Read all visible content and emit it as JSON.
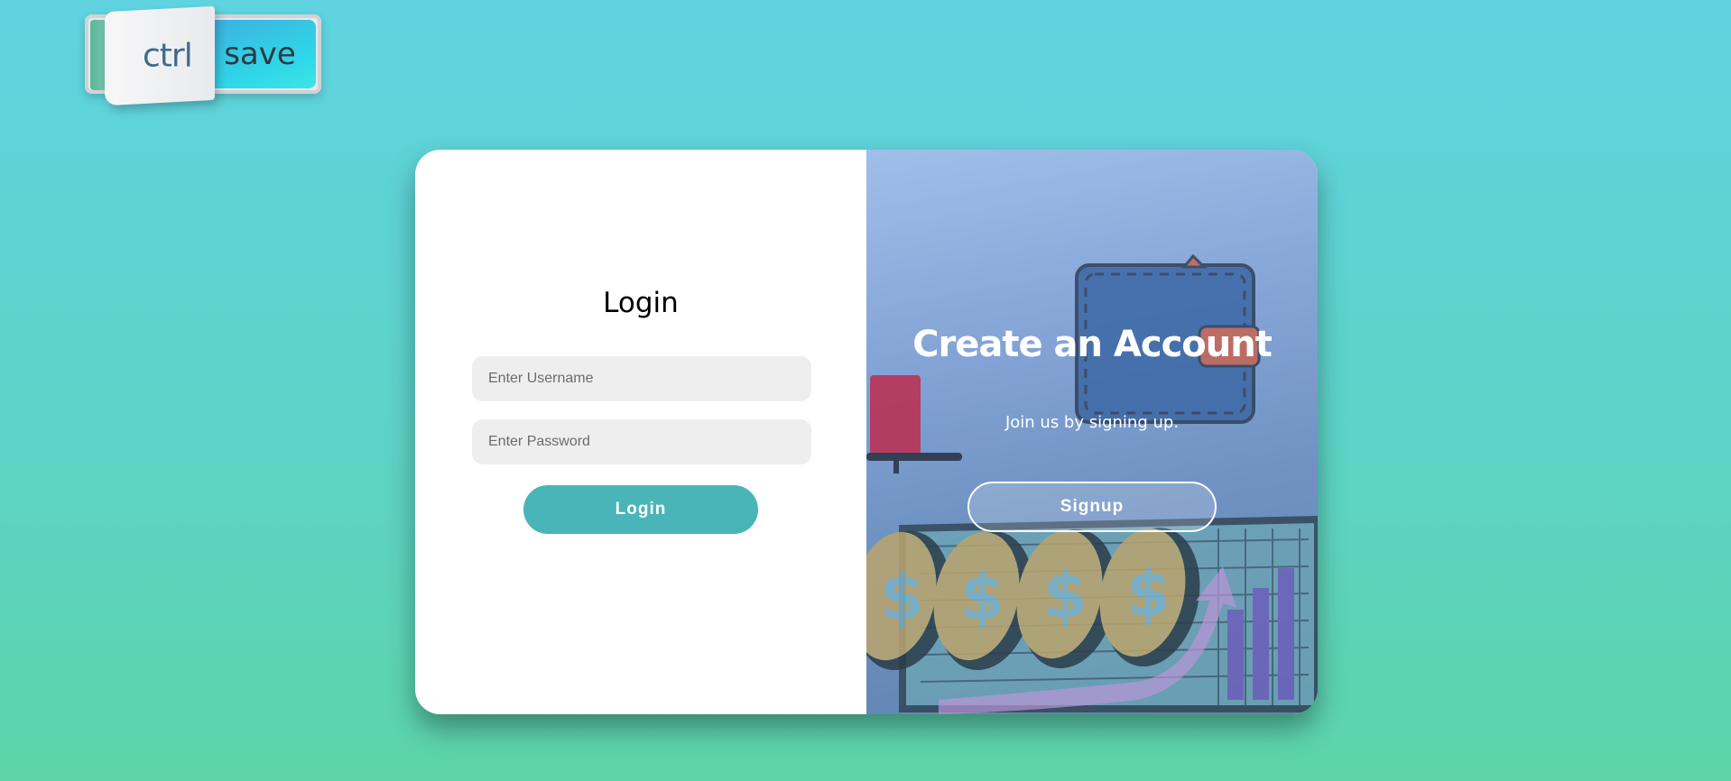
{
  "logo": {
    "ctrl_text": "ctrl",
    "save_text": "save"
  },
  "login": {
    "title": "Login",
    "username_placeholder": "Enter Username",
    "password_placeholder": "Enter Password",
    "button_label": "Login"
  },
  "signup": {
    "title": "Create an Account",
    "subtitle": "Join us by signing up.",
    "button_label": "Signup"
  },
  "colors": {
    "accent": "#4ab5b9",
    "background_top": "#5fd3e0",
    "background_bottom": "#5cd4a8"
  }
}
